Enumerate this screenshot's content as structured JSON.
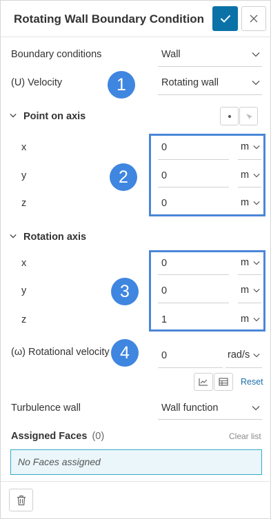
{
  "header": {
    "title": "Rotating Wall Boundary Condition",
    "confirm_icon": "check-icon",
    "close_icon": "close-icon"
  },
  "boundary_conditions": {
    "label": "Boundary conditions",
    "value": "Wall"
  },
  "velocity": {
    "label": "(U) Velocity",
    "value": "Rotating wall"
  },
  "point_on_axis": {
    "label": "Point on axis",
    "rows": [
      {
        "axis": "x",
        "value": "0",
        "unit": "m"
      },
      {
        "axis": "y",
        "value": "0",
        "unit": "m"
      },
      {
        "axis": "z",
        "value": "0",
        "unit": "m"
      }
    ]
  },
  "rotation_axis": {
    "label": "Rotation axis",
    "rows": [
      {
        "axis": "x",
        "value": "0",
        "unit": "m"
      },
      {
        "axis": "y",
        "value": "0",
        "unit": "m"
      },
      {
        "axis": "z",
        "value": "1",
        "unit": "m"
      }
    ]
  },
  "rotational_velocity": {
    "label": "(ω) Rotational velocity",
    "value": "0",
    "unit": "rad/s",
    "reset_label": "Reset"
  },
  "turbulence_wall": {
    "label": "Turbulence wall",
    "value": "Wall function"
  },
  "assigned_faces": {
    "label": "Assigned Faces",
    "count": "(0)",
    "clear_label": "Clear list",
    "empty_text": "No Faces assigned"
  },
  "badges": [
    "1",
    "2",
    "3",
    "4"
  ],
  "colors": {
    "accent": "#0b72a8",
    "badge": "#3f86e0",
    "highlight": "#4a86d8",
    "faces_border": "#35a9c7"
  }
}
